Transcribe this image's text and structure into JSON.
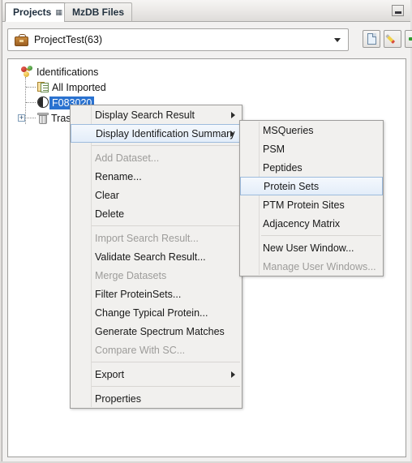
{
  "window": {
    "minimize_button": "minimize"
  },
  "tabs": [
    {
      "label": "Projects",
      "active": true,
      "pin_icon": "pin-icon"
    },
    {
      "label": "MzDB Files",
      "active": false
    }
  ],
  "toolbar": {
    "project_selector": {
      "value": "ProjectTest(63)",
      "icon": "briefcase-icon",
      "dropdown_icon": "chevron-down-icon"
    },
    "buttons": [
      {
        "name": "new-project-button",
        "icon": "page-icon",
        "label": ""
      },
      {
        "name": "edit-project-button",
        "icon": "pencil-icon",
        "label": ""
      },
      {
        "name": "add-project-button",
        "icon": "green-plus-icon",
        "label": ""
      }
    ]
  },
  "tree": {
    "nodes": [
      {
        "label": "Identifications",
        "icon": "identifications-icon",
        "selected": false,
        "expander": null
      },
      {
        "label": "All Imported",
        "icon": "documents-icon",
        "selected": false,
        "expander": null
      },
      {
        "label": "F083020",
        "icon": "pie-icon",
        "selected": true,
        "expander": null
      },
      {
        "label": "Trash",
        "icon": "trash-icon",
        "selected": false,
        "expander": "+"
      }
    ]
  },
  "context_menu": {
    "items": [
      {
        "label": "Display Search Result",
        "submenu": true,
        "disabled": false,
        "highlighted": false
      },
      {
        "label": "Display Identification Summary",
        "submenu": true,
        "disabled": false,
        "highlighted": true
      },
      {
        "separator": true
      },
      {
        "label": "Add Dataset...",
        "submenu": false,
        "disabled": true,
        "highlighted": false
      },
      {
        "label": "Rename...",
        "submenu": false,
        "disabled": false,
        "highlighted": false
      },
      {
        "label": "Clear",
        "submenu": false,
        "disabled": false,
        "highlighted": false
      },
      {
        "label": "Delete",
        "submenu": false,
        "disabled": false,
        "highlighted": false
      },
      {
        "separator": true
      },
      {
        "label": "Import Search Result...",
        "submenu": false,
        "disabled": true,
        "highlighted": false
      },
      {
        "label": "Validate Search Result...",
        "submenu": false,
        "disabled": false,
        "highlighted": false
      },
      {
        "label": "Merge Datasets",
        "submenu": false,
        "disabled": true,
        "highlighted": false
      },
      {
        "label": "Filter ProteinSets...",
        "submenu": false,
        "disabled": false,
        "highlighted": false
      },
      {
        "label": "Change Typical Protein...",
        "submenu": false,
        "disabled": false,
        "highlighted": false
      },
      {
        "label": "Generate Spectrum Matches",
        "submenu": false,
        "disabled": false,
        "highlighted": false
      },
      {
        "label": "Compare With SC...",
        "submenu": false,
        "disabled": true,
        "highlighted": false
      },
      {
        "separator": true
      },
      {
        "label": "Export",
        "submenu": true,
        "disabled": false,
        "highlighted": false
      },
      {
        "separator": true
      },
      {
        "label": "Properties",
        "submenu": false,
        "disabled": false,
        "highlighted": false
      }
    ]
  },
  "submenu": {
    "title": "Display Identification Summary",
    "items": [
      {
        "label": "MSQueries",
        "disabled": false,
        "highlighted": false
      },
      {
        "label": "PSM",
        "disabled": false,
        "highlighted": false
      },
      {
        "label": "Peptides",
        "disabled": false,
        "highlighted": false
      },
      {
        "label": "Protein Sets",
        "disabled": false,
        "highlighted": true
      },
      {
        "label": "PTM Protein Sites",
        "disabled": false,
        "highlighted": false
      },
      {
        "label": "Adjacency Matrix",
        "disabled": false,
        "highlighted": false
      },
      {
        "separator": true
      },
      {
        "label": "New User Window...",
        "disabled": false,
        "highlighted": false
      },
      {
        "label": "Manage User Windows...",
        "disabled": true,
        "highlighted": false
      }
    ]
  },
  "colors": {
    "selection_blue": "#2a72d0",
    "highlight_border": "#9dbbdd",
    "menu_bg": "#f1f0ee",
    "disabled_text": "#9d9c9a"
  }
}
